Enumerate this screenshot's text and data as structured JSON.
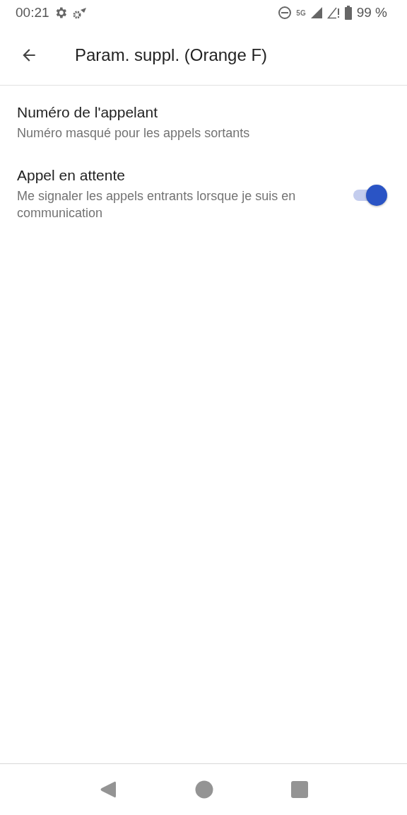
{
  "status_bar": {
    "time": "00:21",
    "network": "5G",
    "battery": "99 %"
  },
  "app_bar": {
    "title": "Param. suppl. (Orange F)"
  },
  "settings": [
    {
      "kind": "text",
      "title": "Numéro de l'appelant",
      "summary": "Numéro masqué pour les appels sortants"
    },
    {
      "kind": "switch",
      "title": "Appel en attente",
      "summary": "Me signaler les appels entrants lorsque je suis en communication",
      "on": true
    }
  ]
}
